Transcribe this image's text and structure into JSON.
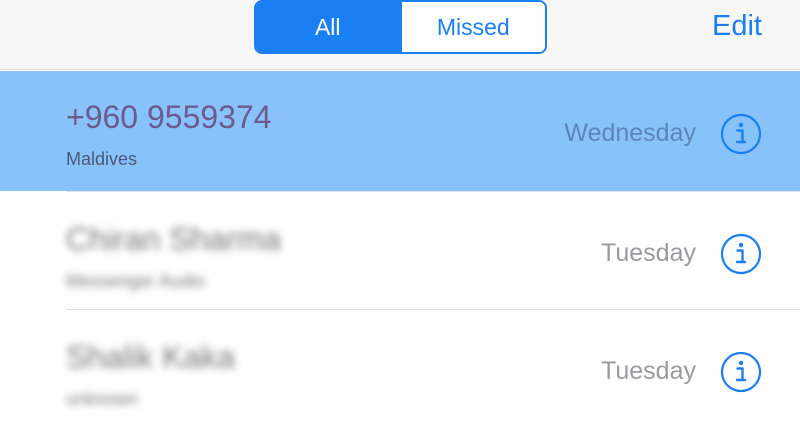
{
  "header": {
    "segments": {
      "all_label": "All",
      "missed_label": "Missed",
      "selected": "All"
    },
    "edit_label": "Edit"
  },
  "calls": [
    {
      "name": "+960 9559374",
      "subtitle": "Maldives",
      "date": "Wednesday",
      "highlighted": true,
      "blurred": false,
      "icon": "info-icon"
    },
    {
      "name": "Chiran Sharma",
      "subtitle": "Messenger Audio",
      "date": "Tuesday",
      "highlighted": false,
      "blurred": true,
      "icon": "info-icon"
    },
    {
      "name": "Shalik Kaka",
      "subtitle": "unknown",
      "date": "Tuesday",
      "highlighted": false,
      "blurred": true,
      "icon": "info-icon"
    }
  ],
  "colors": {
    "accent": "#1a7ff5",
    "highlight_row": "#88c2fb",
    "secondary_text": "#9a9aa0"
  }
}
